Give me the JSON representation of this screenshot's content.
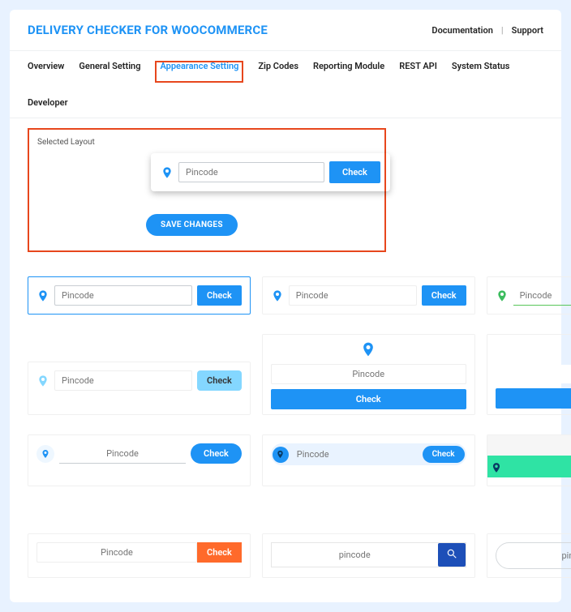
{
  "header": {
    "title": "DELIVERY CHECKER FOR WOOCOMMERCE",
    "links": {
      "docs": "Documentation",
      "support": "Support"
    }
  },
  "tabs": {
    "overview": "Overview",
    "general": "General Setting",
    "appearance": "Appearance Setting",
    "zip": "Zip Codes",
    "reporting": "Reporting Module",
    "rest": "REST API",
    "status": "System Status",
    "developer": "Developer"
  },
  "selected": {
    "label": "Selected Layout",
    "placeholder": "Pincode",
    "check": "Check",
    "save": "SAVE CHANGES"
  },
  "layouts": {
    "placeholder_pincode": "Pincode",
    "placeholder_pincode_lc": "pincode",
    "check": "Check"
  }
}
